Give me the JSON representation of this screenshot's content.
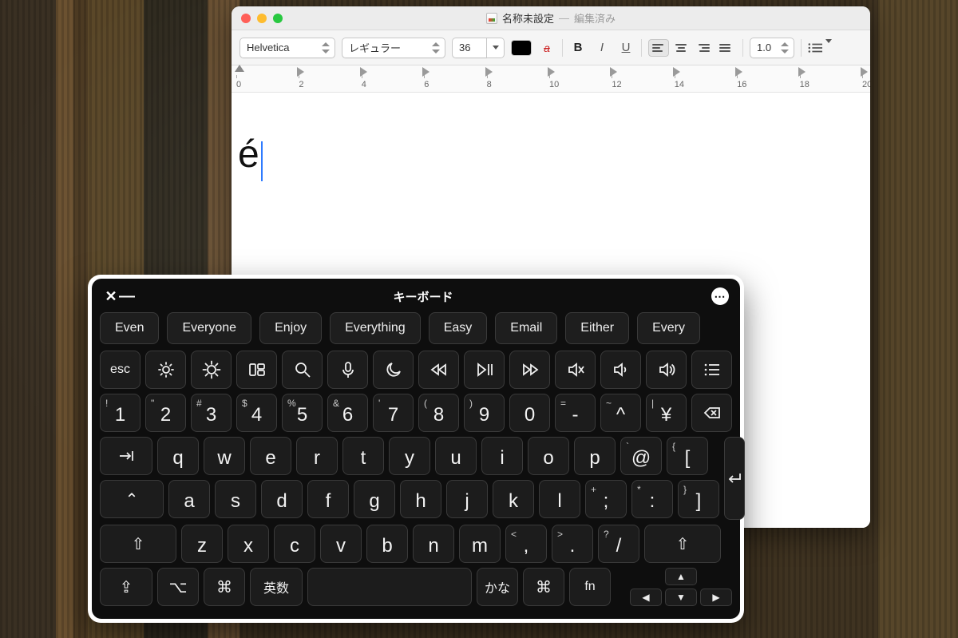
{
  "window": {
    "title": "名称未設定",
    "separator": "—",
    "status": "編集済み"
  },
  "toolbar": {
    "font": "Helvetica",
    "style": "レギュラー",
    "size": "36",
    "text_color": "#000000",
    "bold": "B",
    "italic": "I",
    "underline": "U",
    "spacing": "1.0"
  },
  "ruler": {
    "labels": [
      "0",
      "2",
      "4",
      "6",
      "8",
      "10",
      "12",
      "14",
      "16",
      "18",
      "20"
    ]
  },
  "document": {
    "text": "é"
  },
  "keyboard": {
    "title": "キーボード",
    "suggestions": [
      "Even",
      "Everyone",
      "Enjoy",
      "Everything",
      "Easy",
      "Email",
      "Either",
      "Every"
    ],
    "fn_row": {
      "esc": "esc"
    },
    "num_row": [
      {
        "sup": "!",
        "main": "1"
      },
      {
        "sup": "\"",
        "main": "2"
      },
      {
        "sup": "#",
        "main": "3"
      },
      {
        "sup": "$",
        "main": "4"
      },
      {
        "sup": "%",
        "main": "5"
      },
      {
        "sup": "&",
        "main": "6"
      },
      {
        "sup": "'",
        "main": "7"
      },
      {
        "sup": "(",
        "main": "8"
      },
      {
        "sup": ")",
        "main": "9"
      },
      {
        "sup": "",
        "main": "0"
      },
      {
        "sup": "=",
        "main": "-"
      },
      {
        "sup": "~",
        "main": "^"
      },
      {
        "sup": "|",
        "main": "¥"
      }
    ],
    "q_row": [
      "q",
      "w",
      "e",
      "r",
      "t",
      "y",
      "u",
      "i",
      "o",
      "p",
      "@",
      "["
    ],
    "q_row_sup": [
      "",
      "",
      "",
      "",
      "",
      "",
      "",
      "",
      "",
      "",
      "`",
      "{"
    ],
    "a_row": [
      "a",
      "s",
      "d",
      "f",
      "g",
      "h",
      "j",
      "k",
      "l",
      ";",
      ":",
      "]"
    ],
    "a_row_sup": [
      "",
      "",
      "",
      "",
      "",
      "",
      "",
      "",
      "",
      "+",
      "*",
      "}"
    ],
    "z_row": [
      "z",
      "x",
      "c",
      "v",
      "b",
      "n",
      "m",
      ",",
      ".",
      "/"
    ],
    "z_row_sup": [
      "",
      "",
      "",
      "",
      "",
      "",
      "",
      "<",
      ">",
      "?"
    ],
    "bottom": {
      "eisu": "英数",
      "kana": "かな",
      "cmd": "⌘",
      "fn": "fn"
    }
  }
}
